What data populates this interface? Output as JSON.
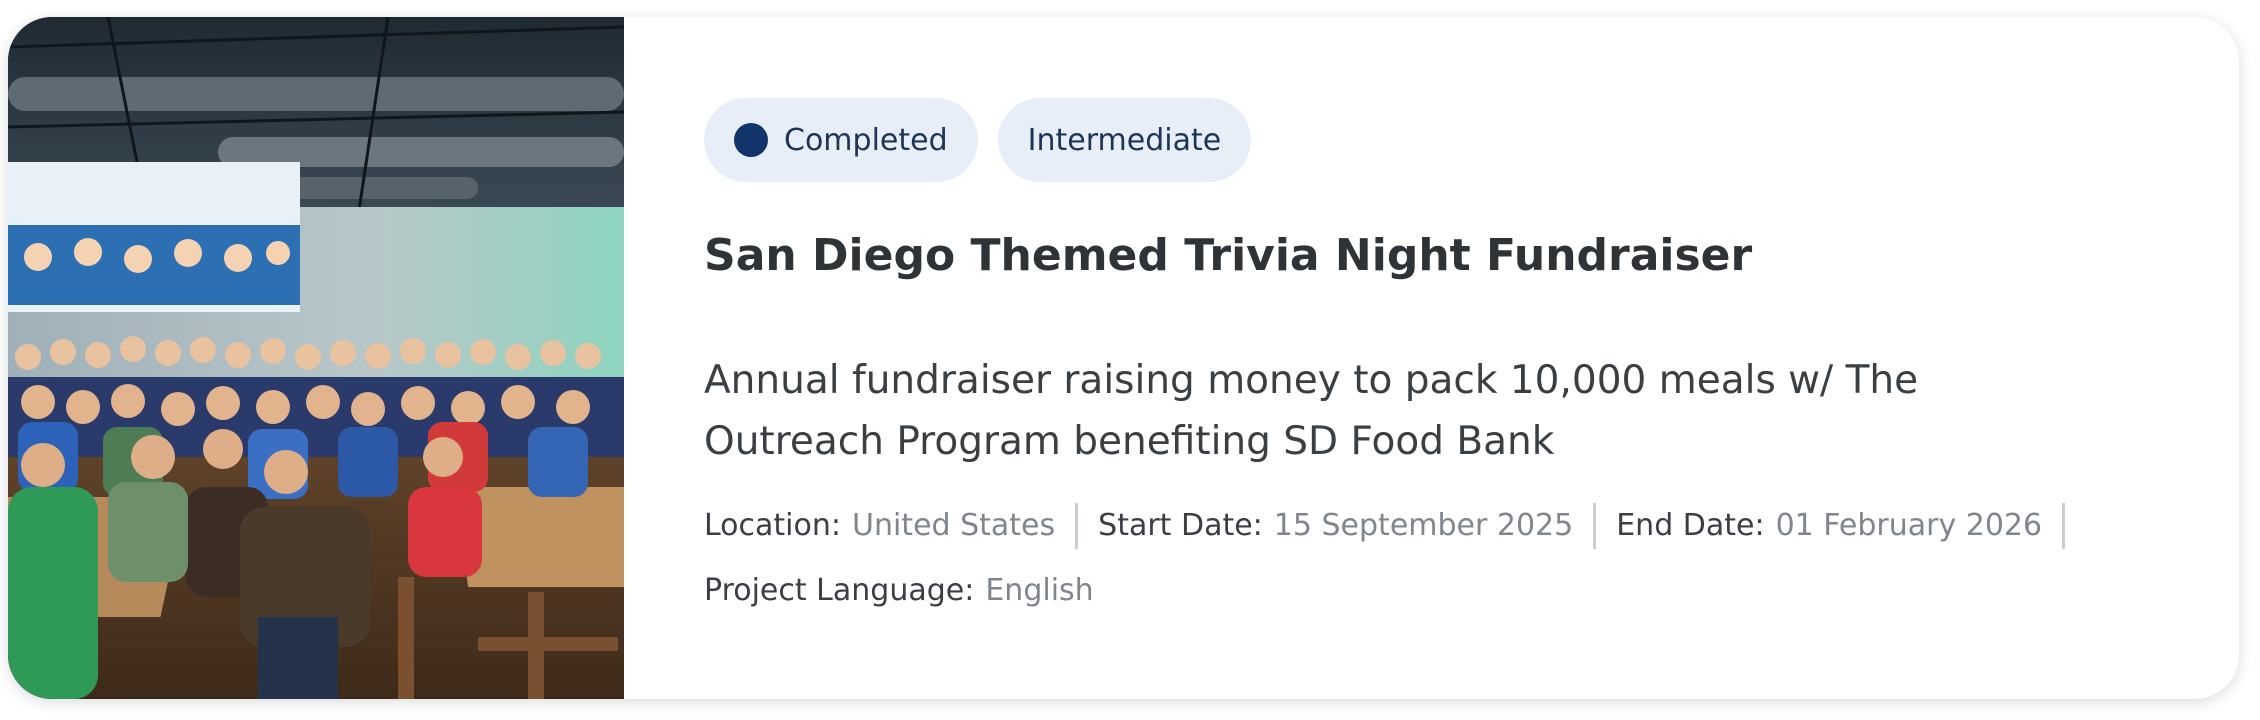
{
  "card": {
    "photo_alt": "Crowd of trivia night participants posing in a restaurant",
    "chips": [
      {
        "label": "Completed",
        "icon": "status-dot-icon",
        "dot_color": "#11356a"
      },
      {
        "label": "Intermediate"
      }
    ],
    "title": "San Diego Themed Trivia Night Fundraiser",
    "description": "Annual fundraiser raising money to pack 10,000 meals w/ The Outreach Program benefiting SD Food Bank",
    "meta": {
      "location_label": "Location:",
      "location_value": "United States",
      "start_label": "Start Date:",
      "start_value": "15 September 2025",
      "end_label": "End Date:",
      "end_value": "01 February 2026",
      "language_label": "Project Language:",
      "language_value": "English"
    }
  },
  "colors": {
    "chip_background": "#e7eef7",
    "chip_text": "#1d3557",
    "title_text": "#2e3338",
    "meta_value_text": "#80868e"
  }
}
